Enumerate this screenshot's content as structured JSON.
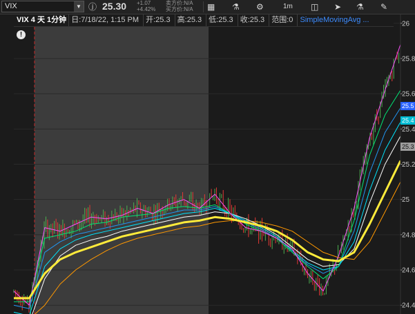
{
  "toolbar": {
    "symbol": "VIX",
    "dropdown_icon": "chevron-down-icon",
    "info_icon": "info-icon",
    "last_price": "25.30",
    "change_abs": "+1.07",
    "change_pct": "+4.42%",
    "bid": "买方价:N/A",
    "ask": "卖方价:N/A",
    "timeframe": "1m",
    "icons": [
      "chart-settings-icon",
      "flask-icon",
      "gear-icon",
      "candlestick-icon",
      "cursor-icon",
      "flask-icon",
      "drawing-icon"
    ]
  },
  "infobar": {
    "title": "VIX 4 天 1分钟",
    "date": "日:7/18/22, 1:15 PM",
    "open": "开:25.3",
    "high": "高:25.3",
    "low": "低:25.3",
    "close": "收:25.3",
    "range": "范围:0",
    "study": "SimpleMovingAvg ..."
  },
  "axis": {
    "ticks": [
      {
        "label": "26",
        "value": 26.0
      },
      {
        "label": "25.8",
        "value": 25.8
      },
      {
        "label": "25.6",
        "value": 25.6
      },
      {
        "label": "25.4",
        "value": 25.4
      },
      {
        "label": "25.2",
        "value": 25.2
      },
      {
        "label": "25",
        "value": 25.0
      },
      {
        "label": "24.8",
        "value": 24.8
      },
      {
        "label": "24.6",
        "value": 24.6
      },
      {
        "label": "24.4",
        "value": 24.4
      }
    ]
  },
  "price_tags": [
    {
      "label": "25.5",
      "value": 25.53,
      "bg": "#2962ff",
      "fg": "#ffffff"
    },
    {
      "label": "25.4",
      "value": 25.45,
      "bg": "#00bcd4",
      "fg": "#ffffff"
    },
    {
      "label": "25.3",
      "value": 25.3,
      "bg": "#9e9e9e",
      "fg": "#111111"
    }
  ],
  "colors": {
    "background": "#1b1b1b",
    "session_shade": "#3c3c3c",
    "price_up": "#4caf50",
    "price_down": "#e53935",
    "sma_fast": "#ff4dff",
    "sma_2": "#00e676",
    "sma_3": "#2196f3",
    "sma_4": "#00e5ff",
    "sma_5": "#ffffff",
    "sma_slow": "#ffeb3b",
    "sma_slowest": "#ff9800"
  },
  "chart_data": {
    "type": "line",
    "y_range": [
      24.35,
      26.05
    ],
    "x": [
      0,
      4,
      8,
      12,
      16,
      20,
      24,
      28,
      32,
      36,
      40,
      44,
      48,
      52,
      56,
      60,
      64,
      68,
      72,
      76,
      80,
      84,
      88,
      92,
      96,
      100
    ],
    "series": [
      {
        "values": [
          24.48,
          24.4,
          24.84,
          24.82,
          24.86,
          24.9,
          24.89,
          24.91,
          24.95,
          24.92,
          24.97,
          25.0,
          24.95,
          25.03,
          24.92,
          24.84,
          24.82,
          24.78,
          24.72,
          24.58,
          24.48,
          24.68,
          24.95,
          25.35,
          25.62,
          25.88
        ]
      },
      {
        "values": [
          24.42,
          24.42,
          24.78,
          24.8,
          24.82,
          24.86,
          24.87,
          24.9,
          24.91,
          24.92,
          24.95,
          24.96,
          24.95,
          24.97,
          24.92,
          24.86,
          24.82,
          24.78,
          24.7,
          24.62,
          24.55,
          24.62,
          24.88,
          25.25,
          25.48,
          25.62
        ]
      },
      {
        "values": [
          24.4,
          24.38,
          24.7,
          24.76,
          24.8,
          24.82,
          24.84,
          24.86,
          24.88,
          24.9,
          24.92,
          24.94,
          24.94,
          24.96,
          24.92,
          24.87,
          24.83,
          24.78,
          24.7,
          24.63,
          24.58,
          24.62,
          24.82,
          25.15,
          25.38,
          25.52
        ]
      },
      {
        "values": [
          24.36,
          24.34,
          24.62,
          24.72,
          24.77,
          24.8,
          24.82,
          24.84,
          24.86,
          24.88,
          24.9,
          24.92,
          24.93,
          24.95,
          24.92,
          24.88,
          24.84,
          24.79,
          24.71,
          24.64,
          24.6,
          24.62,
          24.76,
          25.05,
          25.28,
          25.44
        ]
      },
      {
        "values": [
          24.32,
          24.3,
          24.55,
          24.68,
          24.74,
          24.77,
          24.79,
          24.82,
          24.84,
          24.86,
          24.88,
          24.9,
          24.91,
          24.93,
          24.92,
          24.89,
          24.85,
          24.8,
          24.73,
          24.66,
          24.62,
          24.63,
          24.72,
          24.98,
          25.2,
          25.36
        ]
      },
      {
        "values": [
          24.44,
          24.44,
          24.58,
          24.66,
          24.7,
          24.73,
          24.76,
          24.79,
          24.81,
          24.83,
          24.85,
          24.87,
          24.88,
          24.9,
          24.89,
          24.87,
          24.85,
          24.82,
          24.77,
          24.7,
          24.66,
          24.65,
          24.7,
          24.86,
          25.04,
          25.22
        ]
      },
      {
        "values": [
          24.32,
          24.32,
          24.4,
          24.52,
          24.6,
          24.66,
          24.71,
          24.75,
          24.78,
          24.8,
          24.82,
          24.84,
          24.85,
          24.87,
          24.88,
          24.88,
          24.87,
          24.85,
          24.82,
          24.76,
          24.7,
          24.67,
          24.66,
          24.76,
          24.93,
          25.1
        ]
      }
    ]
  }
}
